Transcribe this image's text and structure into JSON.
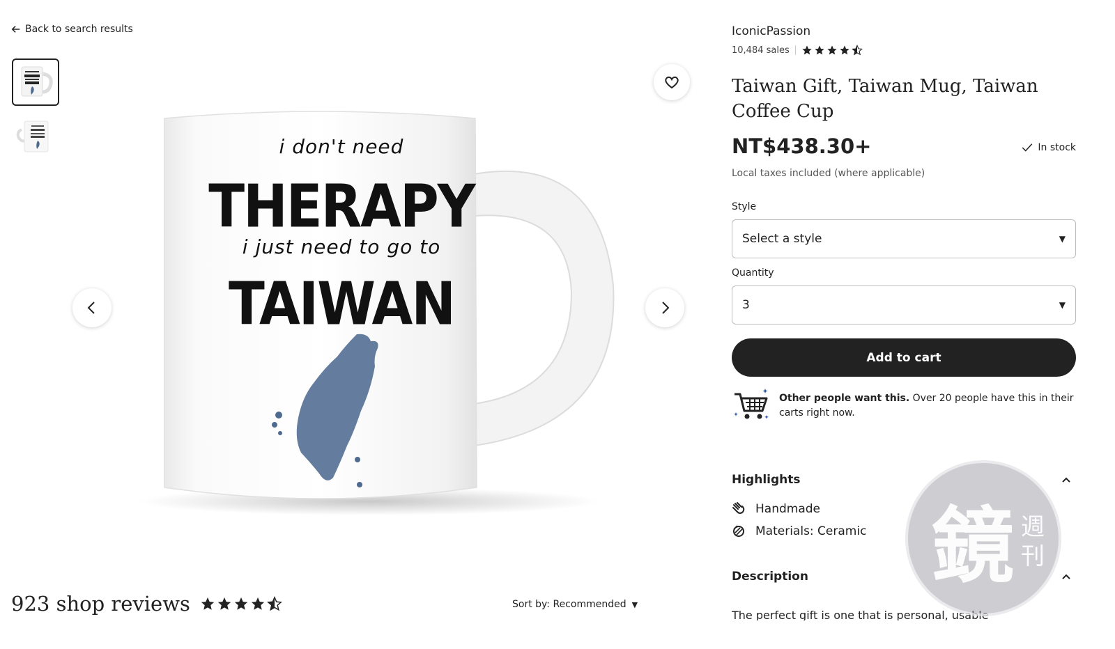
{
  "nav": {
    "back_label": "Back to search results"
  },
  "gallery": {
    "thumbnails": [
      "mug-front",
      "mug-side"
    ],
    "mug_print": {
      "line1": "i don't need",
      "line2": "THERAPY",
      "line3": "i just need to go to",
      "line4": "TAIWAN"
    }
  },
  "reviews": {
    "title": "923 shop reviews",
    "rating": 4.5,
    "sort_label": "Sort by: Recommended"
  },
  "shop": {
    "name": "IconicPassion",
    "sales": "10,484 sales",
    "rating": 4.5
  },
  "product": {
    "title": "Taiwan Gift, Taiwan Mug, Taiwan Coffee Cup",
    "price": "NT$438.30+",
    "stock": "In stock",
    "tax_note": "Local taxes included (where applicable)"
  },
  "options": {
    "style_label": "Style",
    "style_value": "Select a style",
    "quantity_label": "Quantity",
    "quantity_value": "3"
  },
  "cart": {
    "add_label": "Add to cart"
  },
  "social_proof": {
    "bold": "Other people want this.",
    "text": " Over 20 people have this in their carts right now."
  },
  "highlights": {
    "title": "Highlights",
    "items": [
      "Handmade",
      "Materials: Ceramic"
    ]
  },
  "description": {
    "title": "Description",
    "text": "The perfect gift is one that is personal, usable"
  },
  "watermark": {
    "text": "鏡週刊"
  },
  "colors": {
    "primary": "#222222",
    "taiwan_blue": "#4f6a8f",
    "muted": "#555555"
  }
}
